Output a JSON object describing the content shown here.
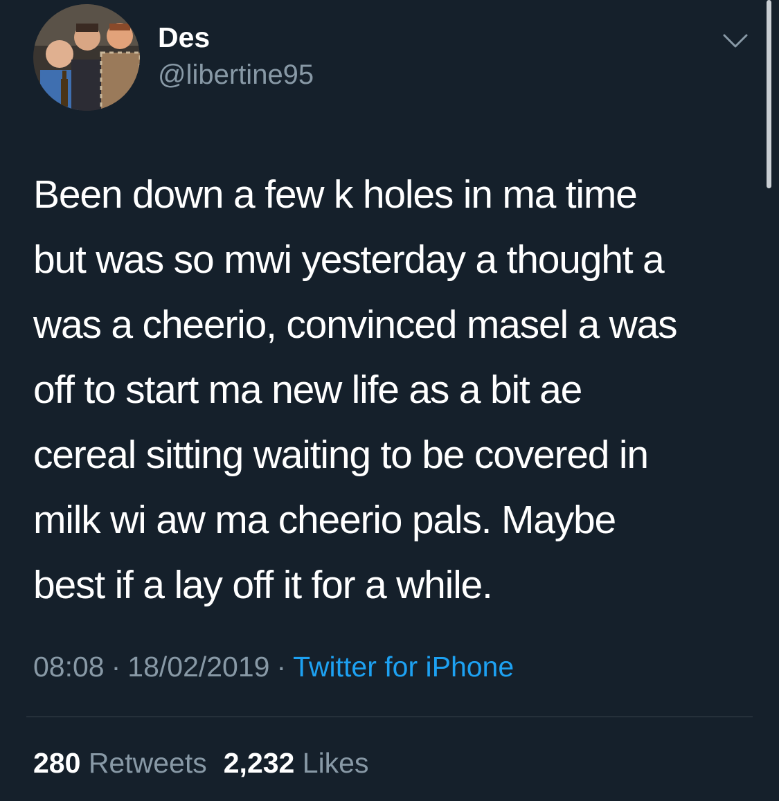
{
  "author": {
    "display_name": "Des",
    "handle": "@libertine95"
  },
  "tweet": {
    "text": "Been down a few k holes in ma time\nbut was so mwi yesterday a thought a\nwas a cheerio, convinced masel a was\noff to start ma new life as a bit ae\ncereal sitting waiting to be covered in\nmilk wi aw ma cheerio pals. Maybe\nbest if a lay off it for a while.",
    "time": "08:08",
    "separator": "·",
    "date": "18/02/2019",
    "source": "Twitter for iPhone"
  },
  "stats": {
    "retweets_count": "280",
    "retweets_label": "Retweets",
    "likes_count": "2,232",
    "likes_label": "Likes"
  },
  "icons": {
    "caret": "chevron-down-icon"
  },
  "colors": {
    "background": "#15202b",
    "primary_text": "#ffffff",
    "secondary_text": "#8899a6",
    "link": "#1da1f2",
    "divider": "#38444d"
  }
}
